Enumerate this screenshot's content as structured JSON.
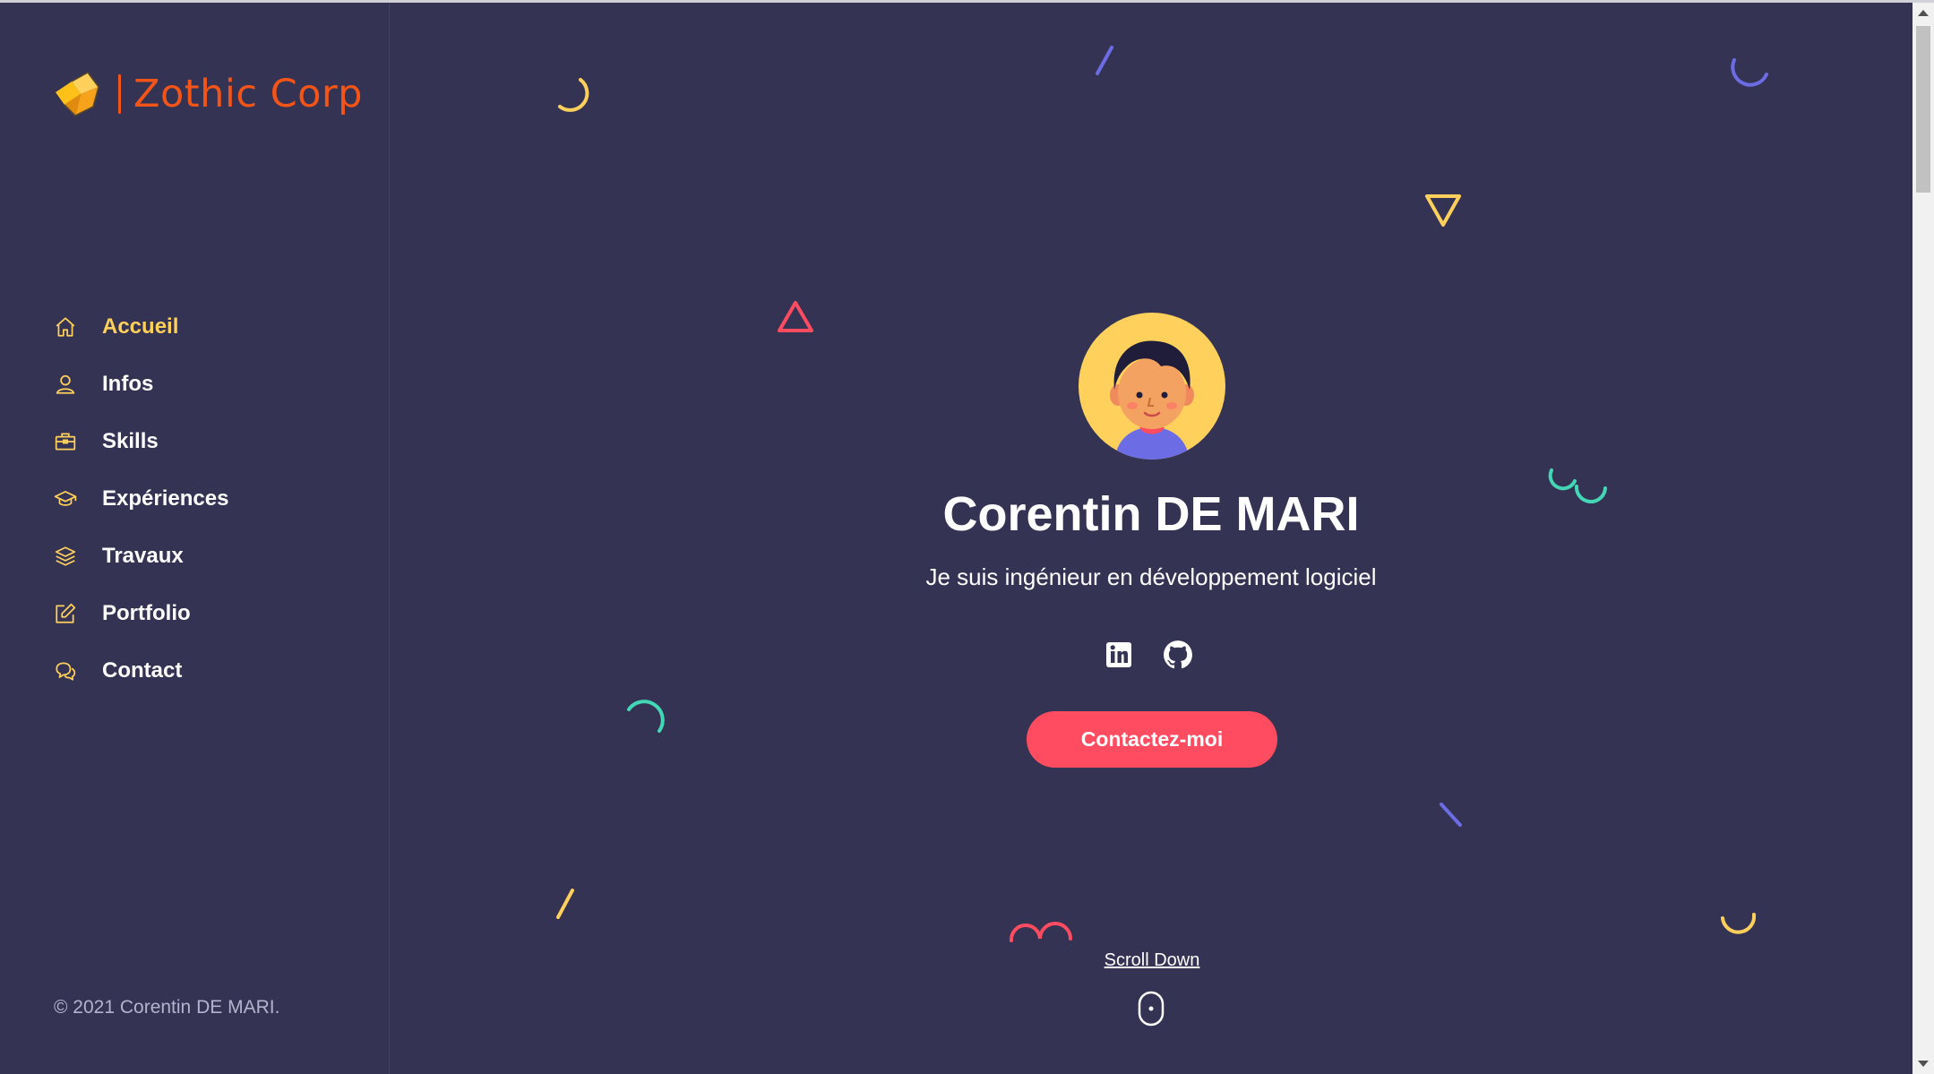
{
  "brand": {
    "name": "Zothic Corp",
    "color": "#f35418"
  },
  "colors": {
    "background": "#353353",
    "accent_yellow": "#ffd15c",
    "accent_red": "#ff4c60",
    "accent_purple": "#6c6ce5",
    "accent_teal": "#44d7b6"
  },
  "nav": {
    "items": [
      {
        "label": "Accueil",
        "icon": "home-icon",
        "active": true
      },
      {
        "label": "Infos",
        "icon": "user-icon",
        "active": false
      },
      {
        "label": "Skills",
        "icon": "briefcase-icon",
        "active": false
      },
      {
        "label": "Expériences",
        "icon": "graduation-cap-icon",
        "active": false
      },
      {
        "label": "Travaux",
        "icon": "layers-icon",
        "active": false
      },
      {
        "label": "Portfolio",
        "icon": "edit-icon",
        "active": false
      },
      {
        "label": "Contact",
        "icon": "chat-icon",
        "active": false
      }
    ]
  },
  "footer": {
    "copyright": "© 2021 Corentin DE MARI."
  },
  "hero": {
    "name": "Corentin DE MARI",
    "subtitle": "Je suis ingénieur en développement logiciel",
    "socials": [
      {
        "icon": "linkedin-icon"
      },
      {
        "icon": "github-icon"
      }
    ],
    "cta_label": "Contactez-moi",
    "scroll_label": "Scroll Down"
  }
}
